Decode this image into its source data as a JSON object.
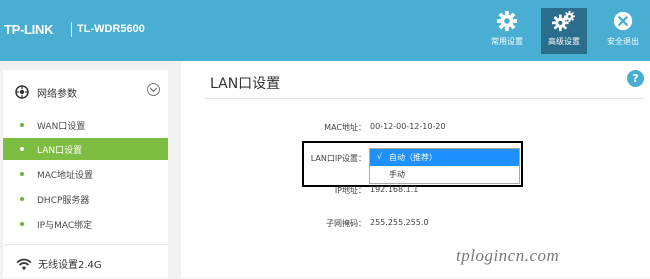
{
  "header": {
    "brand": "TP-LINK",
    "model": "TL-WDR5600",
    "buttons": [
      {
        "label": "常用设置",
        "icon": "gear-icon"
      },
      {
        "label": "高级设置",
        "icon": "gears-icon"
      },
      {
        "label": "安全退出",
        "icon": "close-circle-icon"
      }
    ],
    "accent_color": "#4aaed3",
    "active_button_color": "#2a6d8c"
  },
  "sidebar": {
    "section_title": "网络参数",
    "items": [
      {
        "label": "WAN口设置"
      },
      {
        "label": "LAN口设置"
      },
      {
        "label": "MAC地址设置"
      },
      {
        "label": "DHCP服务器"
      },
      {
        "label": "IP与MAC绑定"
      }
    ],
    "active_item_color": "#7cbd42",
    "section2_title": "无线设置2.4G"
  },
  "main": {
    "title": "LAN口设置",
    "help_label": "?",
    "fields": {
      "mac_label": "MAC地址：",
      "mac_value": "00-12-00-12-10-20",
      "ip_setting_label": "LAN口IP设置：",
      "ip_label": "IP地址：",
      "ip_value": "192.168.1.1",
      "mask_label": "子网掩码：",
      "mask_value": "255.255.255.0"
    },
    "dropdown": {
      "options": [
        {
          "label": "自动（推荐）",
          "check": "√"
        },
        {
          "label": "手动",
          "check": ""
        }
      ]
    }
  },
  "watermark": "tplogincn.com"
}
